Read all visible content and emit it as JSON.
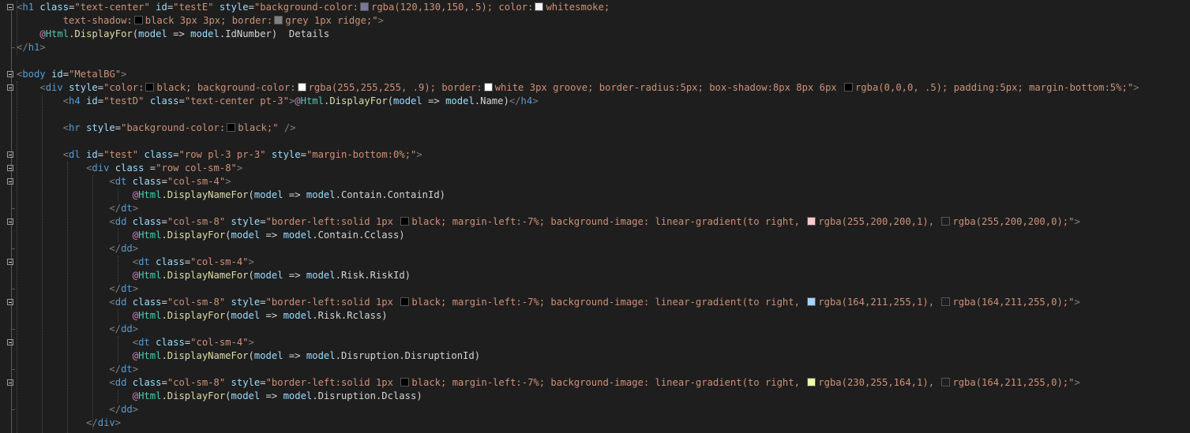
{
  "editor": {
    "colors": {
      "background": "#1e1e1e",
      "tag": "#569cd6",
      "attribute": "#9cdcfe",
      "string": "#ce9178",
      "razor": "#c586c0",
      "method": "#dcdcaa",
      "text": "#d4d4d4"
    },
    "lines": [
      [
        [
          "p",
          "<"
        ],
        [
          "t",
          "h1"
        ],
        [
          "x",
          " "
        ],
        [
          "a",
          "class"
        ],
        [
          "x",
          "="
        ],
        [
          "s",
          "\"text-center\""
        ],
        [
          "x",
          " "
        ],
        [
          "a",
          "id"
        ],
        [
          "x",
          "="
        ],
        [
          "s",
          "\"testE\""
        ],
        [
          "x",
          " "
        ],
        [
          "a",
          "style"
        ],
        [
          "x",
          "="
        ],
        [
          "s",
          "\"background-color:"
        ],
        [
          "sw",
          "#787896"
        ],
        [
          "s",
          "rgba(120,130,150,.5); color:"
        ],
        [
          "sw",
          "#f5f5f5"
        ],
        [
          "s",
          "whitesmoke;"
        ]
      ],
      [
        [
          "s",
          "        text-shadow:"
        ],
        [
          "sw",
          "#000000"
        ],
        [
          "s",
          "black 3px 3px; border:"
        ],
        [
          "sw",
          "#808080"
        ],
        [
          "s",
          "grey 1px ridge;\""
        ],
        [
          "p",
          ">"
        ]
      ],
      [
        [
          "x",
          "    "
        ],
        [
          "r",
          "@"
        ],
        [
          "k",
          "Html"
        ],
        [
          "x",
          "."
        ],
        [
          "f",
          "DisplayFor"
        ],
        [
          "x",
          "("
        ],
        [
          "a",
          "model"
        ],
        [
          "x",
          " => "
        ],
        [
          "a",
          "model"
        ],
        [
          "x",
          ".IdNumber)  Details"
        ]
      ],
      [
        [
          "p",
          "</"
        ],
        [
          "t",
          "h1"
        ],
        [
          "p",
          ">"
        ]
      ],
      [],
      [
        [
          "p",
          "<"
        ],
        [
          "t",
          "body"
        ],
        [
          "x",
          " "
        ],
        [
          "a",
          "id"
        ],
        [
          "x",
          "="
        ],
        [
          "s",
          "\"MetalBG\""
        ],
        [
          "p",
          ">"
        ]
      ],
      [
        [
          "x",
          "    "
        ],
        [
          "p",
          "<"
        ],
        [
          "t",
          "div"
        ],
        [
          "x",
          " "
        ],
        [
          "a",
          "style"
        ],
        [
          "x",
          "="
        ],
        [
          "s",
          "\"color:"
        ],
        [
          "sw",
          "#000000"
        ],
        [
          "s",
          "black; background-color:"
        ],
        [
          "sw",
          "#ffffff"
        ],
        [
          "s",
          "rgba(255,255,255, .9); border:"
        ],
        [
          "sw",
          "#ffffff"
        ],
        [
          "s",
          "white 3px groove; border-radius:5px; box-shadow:8px 8px 6px "
        ],
        [
          "sw",
          "#000000"
        ],
        [
          "s",
          "rgba(0,0,0, .5); padding:5px; margin-bottom:5%;\""
        ],
        [
          "p",
          ">"
        ]
      ],
      [
        [
          "x",
          "        "
        ],
        [
          "p",
          "<"
        ],
        [
          "t",
          "h4"
        ],
        [
          "x",
          " "
        ],
        [
          "a",
          "id"
        ],
        [
          "x",
          "="
        ],
        [
          "s",
          "\"testD\""
        ],
        [
          "x",
          " "
        ],
        [
          "a",
          "class"
        ],
        [
          "x",
          "="
        ],
        [
          "s",
          "\"text-center pt-3\""
        ],
        [
          "p",
          ">"
        ],
        [
          "r",
          "@"
        ],
        [
          "k",
          "Html"
        ],
        [
          "x",
          "."
        ],
        [
          "f",
          "DisplayFor"
        ],
        [
          "x",
          "("
        ],
        [
          "a",
          "model"
        ],
        [
          "x",
          " => "
        ],
        [
          "a",
          "model"
        ],
        [
          "x",
          ".Name)"
        ],
        [
          "p",
          "</"
        ],
        [
          "t",
          "h4"
        ],
        [
          "p",
          ">"
        ]
      ],
      [],
      [
        [
          "x",
          "        "
        ],
        [
          "p",
          "<"
        ],
        [
          "t",
          "hr"
        ],
        [
          "x",
          " "
        ],
        [
          "a",
          "style"
        ],
        [
          "x",
          "="
        ],
        [
          "s",
          "\"background-color:"
        ],
        [
          "sw",
          "#000000"
        ],
        [
          "s",
          "black;\""
        ],
        [
          "x",
          " "
        ],
        [
          "p",
          "/>"
        ]
      ],
      [],
      [
        [
          "x",
          "        "
        ],
        [
          "p",
          "<"
        ],
        [
          "t",
          "dl"
        ],
        [
          "x",
          " "
        ],
        [
          "a",
          "id"
        ],
        [
          "x",
          "="
        ],
        [
          "s",
          "\"test\""
        ],
        [
          "x",
          " "
        ],
        [
          "a",
          "class"
        ],
        [
          "x",
          "="
        ],
        [
          "s",
          "\"row pl-3 pr-3\""
        ],
        [
          "x",
          " "
        ],
        [
          "a",
          "style"
        ],
        [
          "x",
          "="
        ],
        [
          "s",
          "\"margin-bottom:0%;\""
        ],
        [
          "p",
          ">"
        ]
      ],
      [
        [
          "x",
          "            "
        ],
        [
          "p",
          "<"
        ],
        [
          "t",
          "div"
        ],
        [
          "x",
          " "
        ],
        [
          "a",
          "class"
        ],
        [
          "x",
          " ="
        ],
        [
          "s",
          "\"row col-sm-8\""
        ],
        [
          "p",
          ">"
        ]
      ],
      [
        [
          "x",
          "                "
        ],
        [
          "p",
          "<"
        ],
        [
          "t",
          "dt"
        ],
        [
          "x",
          " "
        ],
        [
          "a",
          "class"
        ],
        [
          "x",
          "="
        ],
        [
          "s",
          "\"col-sm-4\""
        ],
        [
          "p",
          ">"
        ]
      ],
      [
        [
          "x",
          "                    "
        ],
        [
          "r",
          "@"
        ],
        [
          "k",
          "Html"
        ],
        [
          "x",
          "."
        ],
        [
          "f",
          "DisplayNameFor"
        ],
        [
          "x",
          "("
        ],
        [
          "a",
          "model"
        ],
        [
          "x",
          " => "
        ],
        [
          "a",
          "model"
        ],
        [
          "x",
          ".Contain.ContainId)"
        ]
      ],
      [
        [
          "x",
          "                "
        ],
        [
          "p",
          "</"
        ],
        [
          "t",
          "dt"
        ],
        [
          "p",
          ">"
        ]
      ],
      [
        [
          "x",
          "                "
        ],
        [
          "p",
          "<"
        ],
        [
          "t",
          "dd"
        ],
        [
          "x",
          " "
        ],
        [
          "a",
          "class"
        ],
        [
          "x",
          "="
        ],
        [
          "s",
          "\"col-sm-8\""
        ],
        [
          "x",
          " "
        ],
        [
          "a",
          "style"
        ],
        [
          "x",
          "="
        ],
        [
          "s",
          "\"border-left:solid 1px "
        ],
        [
          "sw",
          "#000000"
        ],
        [
          "s",
          "black; margin-left:-7%; background-image: linear-gradient(to right, "
        ],
        [
          "sw",
          "#ffc8c8"
        ],
        [
          "s",
          "rgba(255,200,200,1), "
        ],
        [
          "sw",
          "#1e1e1e"
        ],
        [
          "s",
          "rgba(255,200,200,0);\""
        ],
        [
          "p",
          ">"
        ]
      ],
      [
        [
          "x",
          "                    "
        ],
        [
          "r",
          "@"
        ],
        [
          "k",
          "Html"
        ],
        [
          "x",
          "."
        ],
        [
          "f",
          "DisplayFor"
        ],
        [
          "x",
          "("
        ],
        [
          "a",
          "model"
        ],
        [
          "x",
          " => "
        ],
        [
          "a",
          "model"
        ],
        [
          "x",
          ".Contain.Cclass)"
        ]
      ],
      [
        [
          "x",
          "                "
        ],
        [
          "p",
          "</"
        ],
        [
          "t",
          "dd"
        ],
        [
          "p",
          ">"
        ]
      ],
      [
        [
          "x",
          "                    "
        ],
        [
          "p",
          "<"
        ],
        [
          "t",
          "dt"
        ],
        [
          "x",
          " "
        ],
        [
          "a",
          "class"
        ],
        [
          "x",
          "="
        ],
        [
          "s",
          "\"col-sm-4\""
        ],
        [
          "p",
          ">"
        ]
      ],
      [
        [
          "x",
          "                    "
        ],
        [
          "r",
          "@"
        ],
        [
          "k",
          "Html"
        ],
        [
          "x",
          "."
        ],
        [
          "f",
          "DisplayNameFor"
        ],
        [
          "x",
          "("
        ],
        [
          "a",
          "model"
        ],
        [
          "x",
          " => "
        ],
        [
          "a",
          "model"
        ],
        [
          "x",
          ".Risk.RiskId)"
        ]
      ],
      [
        [
          "x",
          "                "
        ],
        [
          "p",
          "</"
        ],
        [
          "t",
          "dt"
        ],
        [
          "p",
          ">"
        ]
      ],
      [
        [
          "x",
          "                "
        ],
        [
          "p",
          "<"
        ],
        [
          "t",
          "dd"
        ],
        [
          "x",
          " "
        ],
        [
          "a",
          "class"
        ],
        [
          "x",
          "="
        ],
        [
          "s",
          "\"col-sm-8\""
        ],
        [
          "x",
          " "
        ],
        [
          "a",
          "style"
        ],
        [
          "x",
          "="
        ],
        [
          "s",
          "\"border-left:solid 1px "
        ],
        [
          "sw",
          "#000000"
        ],
        [
          "s",
          "black; margin-left:-7%; background-image: linear-gradient(to right, "
        ],
        [
          "sw",
          "#a4d3ff"
        ],
        [
          "s",
          "rgba(164,211,255,1), "
        ],
        [
          "sw",
          "#1e1e1e"
        ],
        [
          "s",
          "rgba(164,211,255,0);\""
        ],
        [
          "p",
          ">"
        ]
      ],
      [
        [
          "x",
          "                    "
        ],
        [
          "r",
          "@"
        ],
        [
          "k",
          "Html"
        ],
        [
          "x",
          "."
        ],
        [
          "f",
          "DisplayFor"
        ],
        [
          "x",
          "("
        ],
        [
          "a",
          "model"
        ],
        [
          "x",
          " => "
        ],
        [
          "a",
          "model"
        ],
        [
          "x",
          ".Risk.Rclass)"
        ]
      ],
      [
        [
          "x",
          "                "
        ],
        [
          "p",
          "</"
        ],
        [
          "t",
          "dd"
        ],
        [
          "p",
          ">"
        ]
      ],
      [
        [
          "x",
          "                    "
        ],
        [
          "p",
          "<"
        ],
        [
          "t",
          "dt"
        ],
        [
          "x",
          " "
        ],
        [
          "a",
          "class"
        ],
        [
          "x",
          "="
        ],
        [
          "s",
          "\"col-sm-4\""
        ],
        [
          "p",
          ">"
        ]
      ],
      [
        [
          "x",
          "                    "
        ],
        [
          "r",
          "@"
        ],
        [
          "k",
          "Html"
        ],
        [
          "x",
          "."
        ],
        [
          "f",
          "DisplayNameFor"
        ],
        [
          "x",
          "("
        ],
        [
          "a",
          "model"
        ],
        [
          "x",
          " => "
        ],
        [
          "a",
          "model"
        ],
        [
          "x",
          ".Disruption.DisruptionId)"
        ]
      ],
      [
        [
          "x",
          "                "
        ],
        [
          "p",
          "</"
        ],
        [
          "t",
          "dt"
        ],
        [
          "p",
          ">"
        ]
      ],
      [
        [
          "x",
          "                "
        ],
        [
          "p",
          "<"
        ],
        [
          "t",
          "dd"
        ],
        [
          "x",
          " "
        ],
        [
          "a",
          "class"
        ],
        [
          "x",
          "="
        ],
        [
          "s",
          "\"col-sm-8\""
        ],
        [
          "x",
          " "
        ],
        [
          "a",
          "style"
        ],
        [
          "x",
          "="
        ],
        [
          "s",
          "\"border-left:solid 1px "
        ],
        [
          "sw",
          "#000000"
        ],
        [
          "s",
          "black; margin-left:-7%; background-image: linear-gradient(to right, "
        ],
        [
          "sw",
          "#e6ffa4"
        ],
        [
          "s",
          "rgba(230,255,164,1), "
        ],
        [
          "sw",
          "#1e1e1e"
        ],
        [
          "s",
          "rgba(164,211,255,0);\""
        ],
        [
          "p",
          ">"
        ]
      ],
      [
        [
          "x",
          "                    "
        ],
        [
          "r",
          "@"
        ],
        [
          "k",
          "Html"
        ],
        [
          "x",
          "."
        ],
        [
          "f",
          "DisplayFor"
        ],
        [
          "x",
          "("
        ],
        [
          "a",
          "model"
        ],
        [
          "x",
          " => "
        ],
        [
          "a",
          "model"
        ],
        [
          "x",
          ".Disruption.Dclass)"
        ]
      ],
      [
        [
          "x",
          "                "
        ],
        [
          "p",
          "</"
        ],
        [
          "t",
          "dd"
        ],
        [
          "p",
          ">"
        ]
      ],
      [
        [
          "x",
          "            "
        ],
        [
          "p",
          "</"
        ],
        [
          "t",
          "div"
        ],
        [
          "p",
          ">"
        ]
      ]
    ]
  }
}
